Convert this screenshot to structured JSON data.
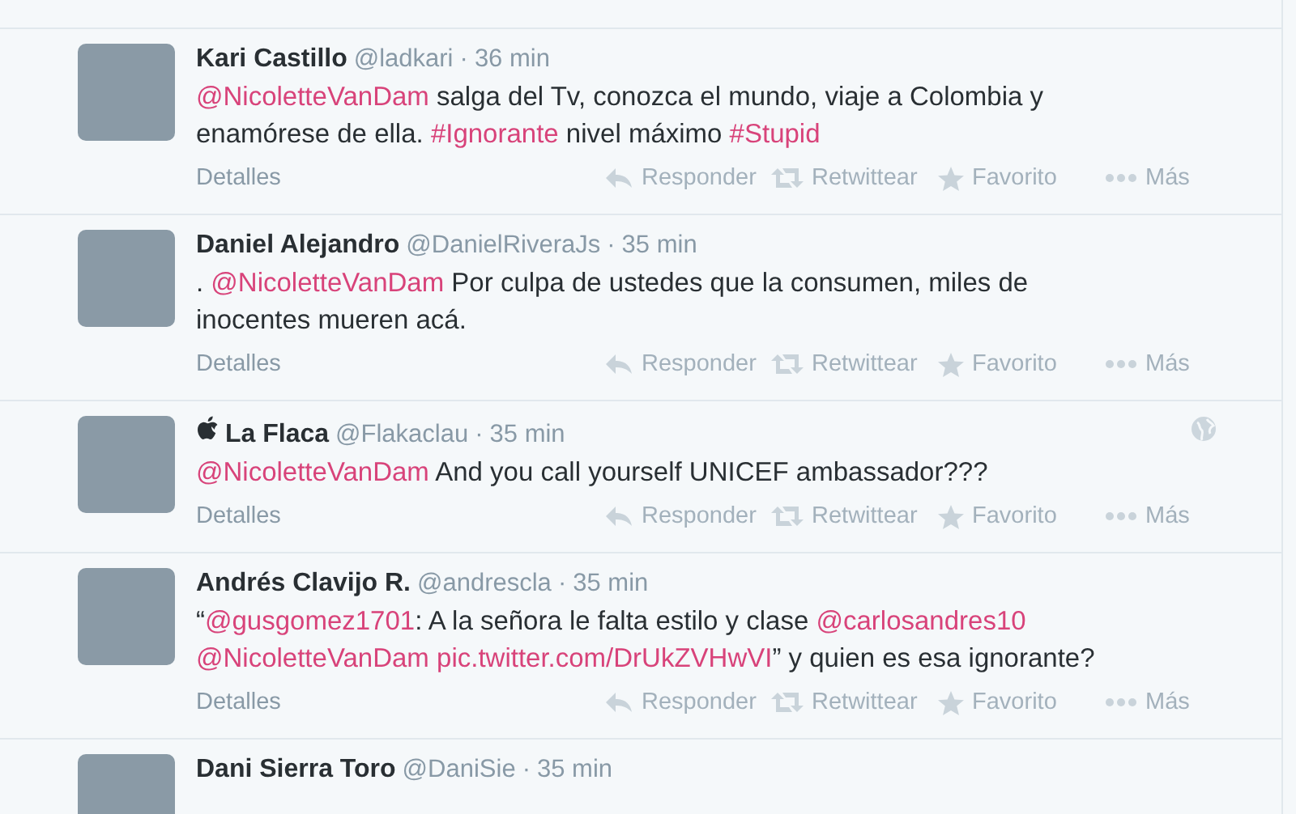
{
  "tweets": [
    {
      "name": "Kari Castillo",
      "apple_logo": false,
      "handle": "@ladkari",
      "separator": "·",
      "time": "36 min",
      "geo": false,
      "lines": [
        [
          {
            "kind": "link",
            "text": "@NicoletteVanDam"
          },
          {
            "kind": "text",
            "text": " salga del Tv, conozca el mundo,  viaje a Colombia y"
          }
        ],
        [
          {
            "kind": "text",
            "text": "enamórese de ella. "
          },
          {
            "kind": "link",
            "text": "#Ignorante"
          },
          {
            "kind": "text",
            "text": " nivel máximo "
          },
          {
            "kind": "link",
            "text": "#Stupid"
          }
        ]
      ],
      "details": "Detalles",
      "actions": [
        {
          "kind": "reply",
          "label": "Responder"
        },
        {
          "kind": "retweet",
          "label": "Retwittear"
        },
        {
          "kind": "favorite",
          "label": "Favorito"
        },
        {
          "kind": "more",
          "label": "Más"
        }
      ]
    },
    {
      "name": "Daniel Alejandro",
      "apple_logo": false,
      "handle": "@DanielRiveraJs",
      "separator": "·",
      "time": "35 min",
      "geo": false,
      "lines": [
        [
          {
            "kind": "text",
            "text": ". "
          },
          {
            "kind": "link",
            "text": "@NicoletteVanDam"
          },
          {
            "kind": "text",
            "text": " Por culpa de ustedes que la consumen, miles de"
          }
        ],
        [
          {
            "kind": "text",
            "text": "inocentes mueren acá."
          }
        ]
      ],
      "details": "Detalles",
      "actions": [
        {
          "kind": "reply",
          "label": "Responder"
        },
        {
          "kind": "retweet",
          "label": "Retwittear"
        },
        {
          "kind": "favorite",
          "label": "Favorito"
        },
        {
          "kind": "more",
          "label": "Más"
        }
      ]
    },
    {
      "name": "La Flaca",
      "apple_logo": true,
      "handle": "@Flakaclau",
      "separator": "·",
      "time": "35 min",
      "geo": true,
      "lines": [
        [
          {
            "kind": "link",
            "text": "@NicoletteVanDam"
          },
          {
            "kind": "text",
            "text": " And you call yourself UNICEF ambassador???"
          }
        ]
      ],
      "details": "Detalles",
      "actions": [
        {
          "kind": "reply",
          "label": "Responder"
        },
        {
          "kind": "retweet",
          "label": "Retwittear"
        },
        {
          "kind": "favorite",
          "label": "Favorito"
        },
        {
          "kind": "more",
          "label": "Más"
        }
      ]
    },
    {
      "name": "Andrés Clavijo R.",
      "apple_logo": false,
      "handle": "@andrescla",
      "separator": "·",
      "time": "35 min",
      "geo": false,
      "lines": [
        [
          {
            "kind": "text",
            "text": "“"
          },
          {
            "kind": "link",
            "text": "@gusgomez1701"
          },
          {
            "kind": "text",
            "text": ": A la señora le falta estilo y clase "
          },
          {
            "kind": "link",
            "text": "@carlosandres10"
          }
        ],
        [
          {
            "kind": "link",
            "text": "@NicoletteVanDam"
          },
          {
            "kind": "space"
          },
          {
            "kind": "link",
            "text": "pic.twitter.com/DrUkZVHwVI"
          },
          {
            "kind": "text",
            "text": "” y quien es esa ignorante?"
          }
        ]
      ],
      "details": "Detalles",
      "actions": [
        {
          "kind": "reply",
          "label": "Responder"
        },
        {
          "kind": "retweet",
          "label": "Retwittear"
        },
        {
          "kind": "favorite",
          "label": "Favorito"
        },
        {
          "kind": "more",
          "label": "Más"
        }
      ]
    },
    {
      "name": "Dani Sierra Toro",
      "apple_logo": false,
      "handle": "@DaniSie",
      "separator": "·",
      "time": "35 min",
      "geo": false
    }
  ]
}
